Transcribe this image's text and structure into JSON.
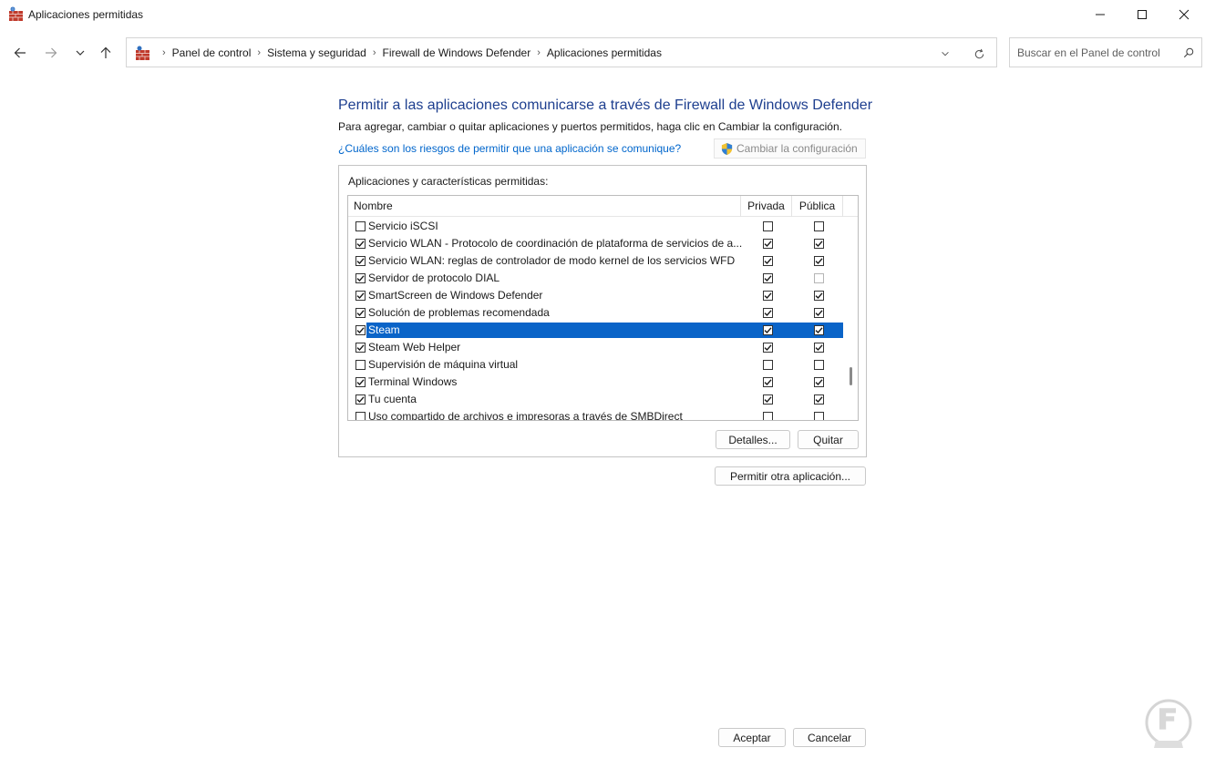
{
  "window": {
    "title": "Aplicaciones permitidas",
    "icon": "firewall-icon",
    "minimize_icon": "minimize-icon",
    "maximize_icon": "maximize-icon",
    "close_icon": "close-icon"
  },
  "navigation": {
    "breadcrumbs": [
      "Panel de control",
      "Sistema y seguridad",
      "Firewall de Windows Defender",
      "Aplicaciones permitidas"
    ],
    "search_placeholder": "Buscar en el Panel de control"
  },
  "main": {
    "heading": "Permitir a las aplicaciones comunicarse a través de Firewall de Windows Defender",
    "description": "Para agregar, cambiar o quitar aplicaciones y puertos permitidos, haga clic en Cambiar la configuración.",
    "risk_link": "¿Cuáles son los riesgos de permitir que una aplicación se comunique?",
    "change_settings_label": "Cambiar la configuración",
    "group_label": "Aplicaciones y características permitidas:",
    "columns": {
      "name": "Nombre",
      "private": "Privada",
      "public": "Pública"
    },
    "rows": [
      {
        "name": "Servicio iSCSI",
        "enabled": false,
        "private": false,
        "public": false,
        "selected": false,
        "public_disabled": false
      },
      {
        "name": "Servicio WLAN - Protocolo de coordinación de plataforma de servicios de a...",
        "enabled": true,
        "private": true,
        "public": true,
        "selected": false,
        "public_disabled": false
      },
      {
        "name": "Servicio WLAN: reglas de controlador de modo kernel de los servicios WFD",
        "enabled": true,
        "private": true,
        "public": true,
        "selected": false,
        "public_disabled": false
      },
      {
        "name": "Servidor de protocolo DIAL",
        "enabled": true,
        "private": true,
        "public": false,
        "selected": false,
        "public_disabled": true
      },
      {
        "name": "SmartScreen de Windows Defender",
        "enabled": true,
        "private": true,
        "public": true,
        "selected": false,
        "public_disabled": false
      },
      {
        "name": "Solución de problemas recomendada",
        "enabled": true,
        "private": true,
        "public": true,
        "selected": false,
        "public_disabled": false
      },
      {
        "name": "Steam",
        "enabled": true,
        "private": true,
        "public": true,
        "selected": true,
        "public_disabled": false
      },
      {
        "name": "Steam Web Helper",
        "enabled": true,
        "private": true,
        "public": true,
        "selected": false,
        "public_disabled": false
      },
      {
        "name": "Supervisión de máquina virtual",
        "enabled": false,
        "private": false,
        "public": false,
        "selected": false,
        "public_disabled": false
      },
      {
        "name": "Terminal Windows",
        "enabled": true,
        "private": true,
        "public": true,
        "selected": false,
        "public_disabled": false
      },
      {
        "name": "Tu cuenta",
        "enabled": true,
        "private": true,
        "public": true,
        "selected": false,
        "public_disabled": false
      },
      {
        "name": "Uso compartido de archivos e impresoras a través de SMBDirect",
        "enabled": false,
        "private": false,
        "public": false,
        "selected": false,
        "public_disabled": false
      }
    ],
    "details_label": "Detalles...",
    "remove_label": "Quitar",
    "allow_other_label": "Permitir otra aplicación..."
  },
  "footer": {
    "ok_label": "Aceptar",
    "cancel_label": "Cancelar"
  },
  "colors": {
    "heading": "#1e3f8f",
    "link": "#0066cc",
    "selection": "#0a64c8"
  }
}
